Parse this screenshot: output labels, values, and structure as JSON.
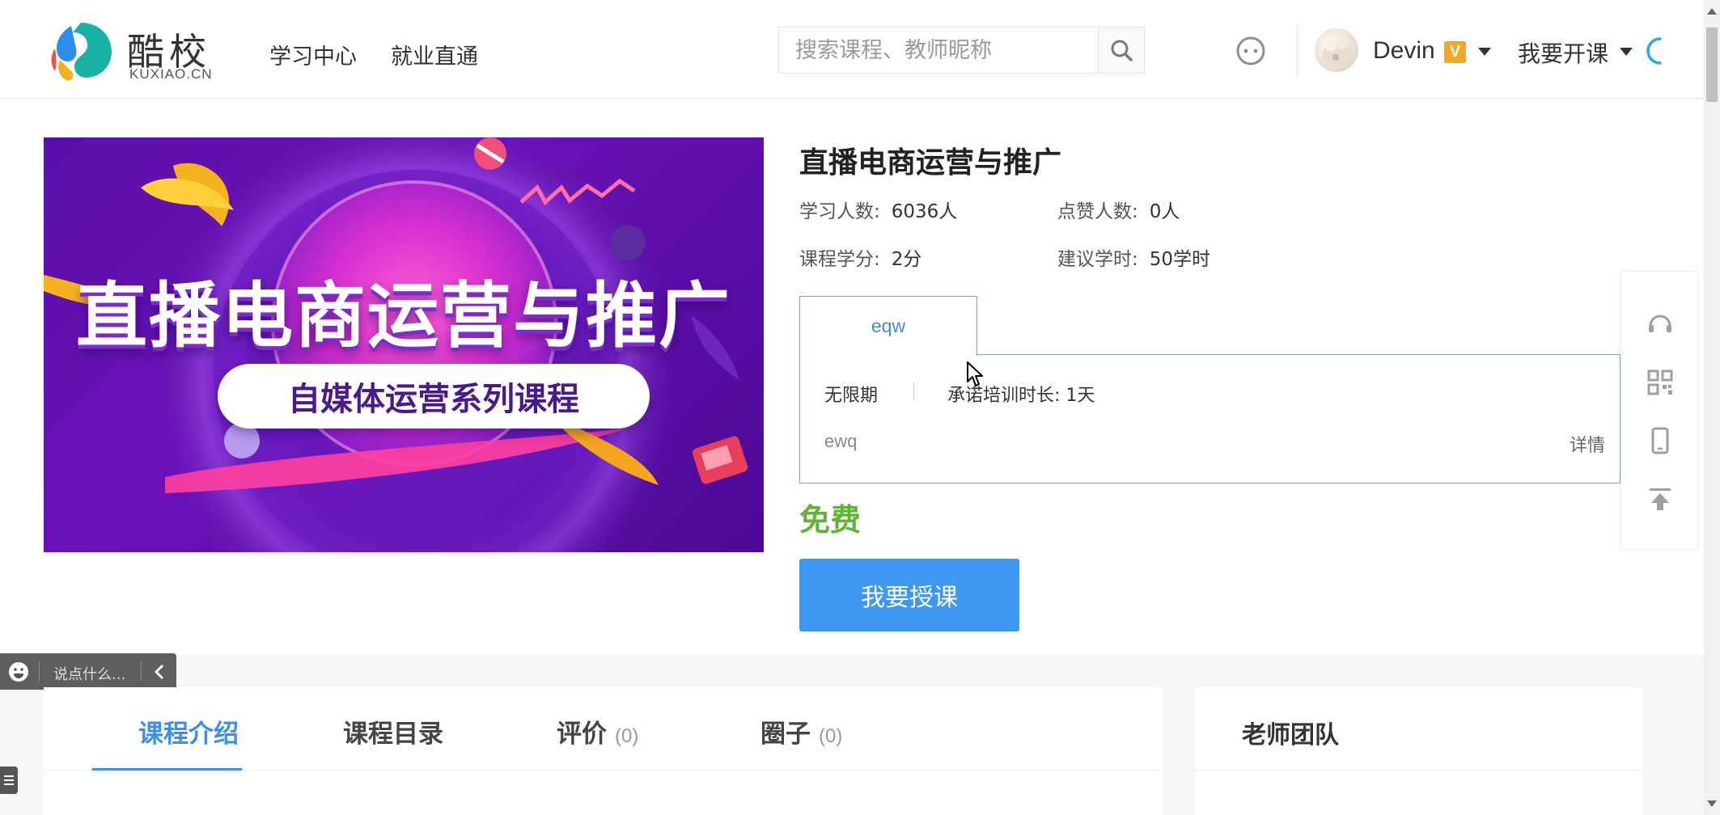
{
  "header": {
    "logo_cn": "酷校",
    "logo_en": "KUXIAO.CN",
    "nav": [
      {
        "label": "学习中心"
      },
      {
        "label": "就业直通"
      }
    ],
    "search_placeholder": "搜索课程、教师昵称",
    "username": "Devin",
    "vip_badge": "V",
    "open_course": "我要开课"
  },
  "course": {
    "banner_title": "直播电商运营与推广",
    "banner_subtitle": "自媒体运营系列课程",
    "title": "直播电商运营与推广",
    "stats": {
      "learners_label": "学习人数:",
      "learners_value": "6036人",
      "likes_label": "点赞人数:",
      "likes_value": "0人",
      "credits_label": "课程学分:",
      "credits_value": "2分",
      "hours_label": "建议学时:",
      "hours_value": "50学时"
    },
    "plan": {
      "tab_label": "eqw",
      "validity": "无限期",
      "duration": "承诺培训时长: 1天",
      "description": "ewq",
      "detail_link": "详情"
    },
    "price": "免费",
    "teach_button": "我要授课"
  },
  "comment_bar": {
    "placeholder": "说点什么..."
  },
  "tabs": [
    {
      "label": "课程介绍",
      "count": ""
    },
    {
      "label": "课程目录",
      "count": ""
    },
    {
      "label": "评价",
      "count": "(0)"
    },
    {
      "label": "圈子",
      "count": "(0)"
    }
  ],
  "teacher_panel": {
    "title": "老师团队"
  },
  "colors": {
    "brand_blue": "#3d97f3",
    "tab_active": "#3d8fe5",
    "free_green": "#5fb636",
    "vip_orange": "#f5a623"
  },
  "icons": {
    "search": "search-icon",
    "chat": "chat-bubble-icon",
    "support": "headset-icon",
    "qrcode": "qrcode-icon",
    "mobile": "mobile-icon",
    "back_to_top": "back-to-top-icon"
  }
}
